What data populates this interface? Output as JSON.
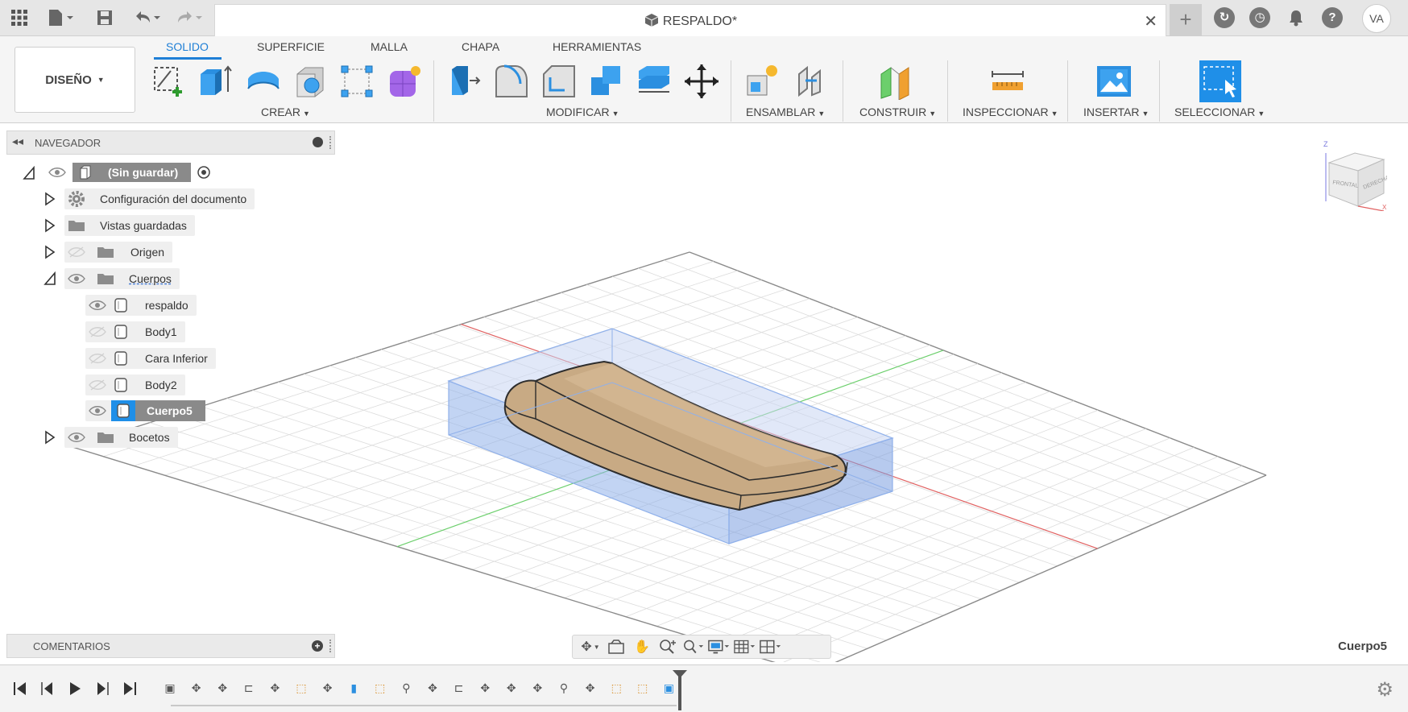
{
  "app": {
    "document_title": "RESPALDO*",
    "user_initials": "VA"
  },
  "ribbon": {
    "workspace": "DISEÑO",
    "tabs": [
      "SOLIDO",
      "SUPERFICIE",
      "MALLA",
      "CHAPA",
      "HERRAMIENTAS"
    ],
    "active_tab": "SOLIDO",
    "groups": [
      "CREAR",
      "MODIFICAR",
      "ENSAMBLAR",
      "CONSTRUIR",
      "INSPECCIONAR",
      "INSERTAR",
      "SELECCIONAR"
    ]
  },
  "navigator": {
    "title": "NAVEGADOR",
    "root": "(Sin guardar)",
    "items": [
      {
        "label": "Configuración del documento"
      },
      {
        "label": "Vistas guardadas"
      },
      {
        "label": "Origen"
      },
      {
        "label": "Cuerpos"
      },
      {
        "label": "respaldo"
      },
      {
        "label": "Body1"
      },
      {
        "label": "Cara Inferior"
      },
      {
        "label": "Body2"
      },
      {
        "label": "Cuerpo5"
      },
      {
        "label": "Bocetos"
      }
    ]
  },
  "viewcube": {
    "left_face": "FRONTAL",
    "right_face": "DERECHA",
    "axis_z": "Z",
    "axis_x": "X"
  },
  "comments": {
    "title": "COMENTARIOS"
  },
  "status": {
    "selected_body": "Cuerpo5"
  },
  "colors": {
    "accent": "#1f7fd6",
    "selection_fill": "#8fb0ea",
    "wood": "#c8aa84",
    "grid_red_axis": "#e06060",
    "grid_green_axis": "#6ccf6c"
  }
}
